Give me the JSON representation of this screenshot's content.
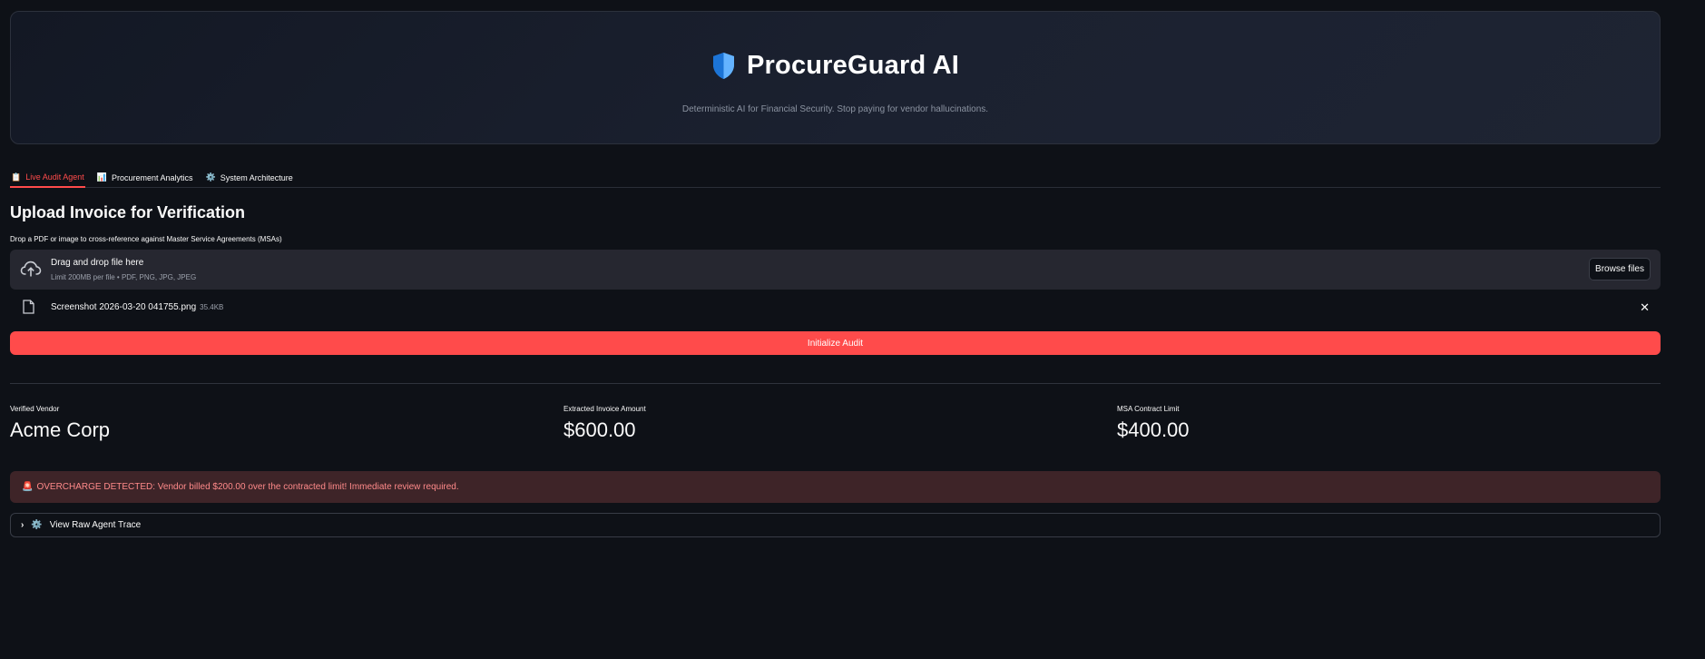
{
  "hero": {
    "title": "ProcureGuard AI",
    "subtitle": "Deterministic AI for Financial Security. Stop paying for vendor hallucinations.",
    "icon": "shield-icon"
  },
  "tabs": [
    {
      "label": "Live Audit Agent",
      "icon": "📋",
      "active": true
    },
    {
      "label": "Procurement Analytics",
      "icon": "📊",
      "active": false
    },
    {
      "label": "System Architecture",
      "icon": "⚙️",
      "active": false
    }
  ],
  "upload": {
    "heading": "Upload Invoice for Verification",
    "label": "Drop a PDF or image to cross-reference against Master Service Agreements (MSAs)",
    "drop_title": "Drag and drop file here",
    "limit": "Limit 200MB per file • PDF, PNG, JPG, JPEG",
    "browse_label": "Browse files"
  },
  "file": {
    "name": "Screenshot 2026-03-20 041755.png",
    "size": "35.4KB"
  },
  "actions": {
    "init_label": "Initialize Audit"
  },
  "metrics": [
    {
      "label": "Verified Vendor",
      "value": "Acme Corp"
    },
    {
      "label": "Extracted Invoice Amount",
      "value": "$600.00"
    },
    {
      "label": "MSA Contract Limit",
      "value": "$400.00"
    }
  ],
  "alert": {
    "icon": "🚨",
    "text": "OVERCHARGE DETECTED: Vendor billed $200.00 over the contracted limit! Immediate review required."
  },
  "expander": {
    "icon": "⚙️",
    "label": "View Raw Agent Trace"
  },
  "colors": {
    "background": "#0e1117",
    "accent": "#ff4b4b",
    "alert_bg": "#3e2428",
    "alert_text": "#ff8a8a"
  }
}
